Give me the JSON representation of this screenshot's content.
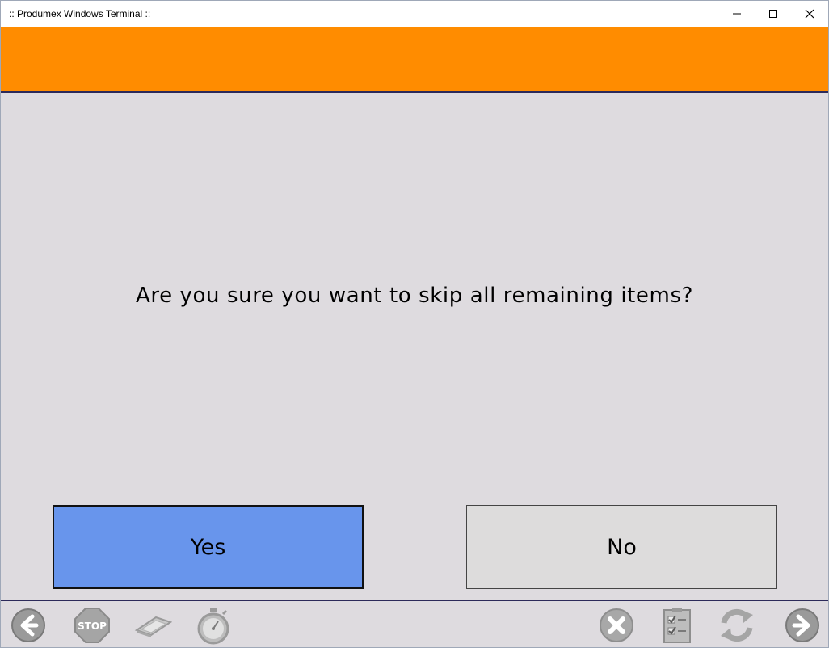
{
  "window": {
    "title": ":: Produmex Windows Terminal ::",
    "controls": {
      "minimize": "minimize",
      "maximize": "maximize",
      "close": "close"
    }
  },
  "header": {
    "accent_color": "#ff8c00"
  },
  "dialog": {
    "question": "Are you sure you want to skip all remaining items?",
    "yes_label": "Yes",
    "no_label": "No",
    "yes_color": "#6895ec",
    "no_color": "#dddcdc"
  },
  "footer": {
    "left_icons": [
      "back-arrow-icon",
      "stop-sign-icon",
      "scanner-icon",
      "stopwatch-icon"
    ],
    "stop_text": "STOP",
    "right_icons": [
      "cancel-icon",
      "checklist-icon",
      "refresh-icon",
      "forward-arrow-icon"
    ]
  }
}
